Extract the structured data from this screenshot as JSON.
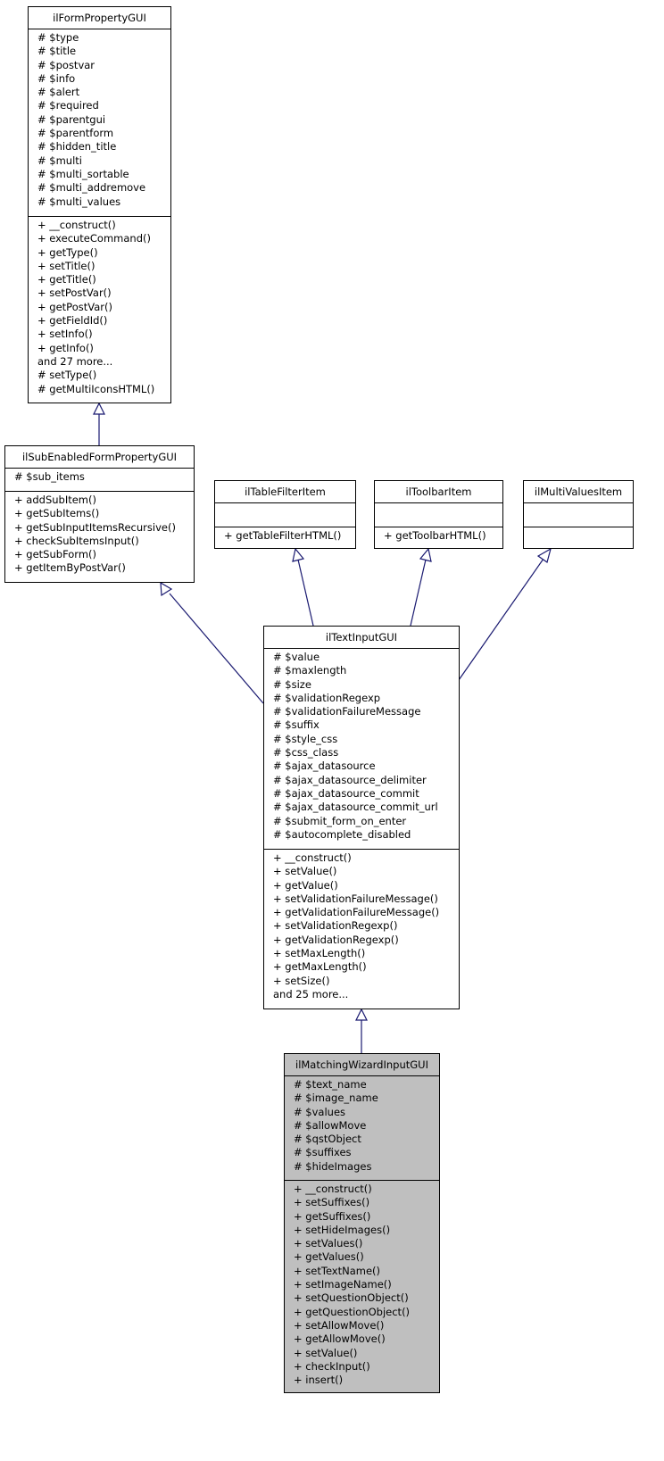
{
  "diagram": {
    "type": "class-inheritance",
    "classes": {
      "ilFormPropertyGUI": {
        "name": "ilFormPropertyGUI",
        "attributes": [
          "# $type",
          "# $title",
          "# $postvar",
          "# $info",
          "# $alert",
          "# $required",
          "# $parentgui",
          "# $parentform",
          "# $hidden_title",
          "# $multi",
          "# $multi_sortable",
          "# $multi_addremove",
          "# $multi_values"
        ],
        "methods": [
          "+ __construct()",
          "+ executeCommand()",
          "+ getType()",
          "+ setTitle()",
          "+ getTitle()",
          "+ setPostVar()",
          "+ getPostVar()",
          "+ getFieldId()",
          "+ setInfo()",
          "+ getInfo()",
          "and 27 more...",
          "# setType()",
          "# getMultiIconsHTML()"
        ]
      },
      "ilSubEnabledFormPropertyGUI": {
        "name": "ilSubEnabledFormPropertyGUI",
        "attributes": [
          "# $sub_items"
        ],
        "methods": [
          "+ addSubItem()",
          "+ getSubItems()",
          "+ getSubInputItemsRecursive()",
          "+ checkSubItemsInput()",
          "+ getSubForm()",
          "+ getItemByPostVar()"
        ]
      },
      "ilTableFilterItem": {
        "name": "ilTableFilterItem",
        "attributes": [],
        "methods": [
          "+ getTableFilterHTML()"
        ]
      },
      "ilToolbarItem": {
        "name": "ilToolbarItem",
        "attributes": [],
        "methods": [
          "+ getToolbarHTML()"
        ]
      },
      "ilMultiValuesItem": {
        "name": "ilMultiValuesItem",
        "attributes": [],
        "methods": []
      },
      "ilTextInputGUI": {
        "name": "ilTextInputGUI",
        "attributes": [
          "# $value",
          "# $maxlength",
          "# $size",
          "# $validationRegexp",
          "# $validationFailureMessage",
          "# $suffix",
          "# $style_css",
          "# $css_class",
          "# $ajax_datasource",
          "# $ajax_datasource_delimiter",
          "# $ajax_datasource_commit",
          "# $ajax_datasource_commit_url",
          "# $submit_form_on_enter",
          "# $autocomplete_disabled"
        ],
        "methods": [
          "+ __construct()",
          "+ setValue()",
          "+ getValue()",
          "+ setValidationFailureMessage()",
          "+ getValidationFailureMessage()",
          "+ setValidationRegexp()",
          "+ getValidationRegexp()",
          "+ setMaxLength()",
          "+ getMaxLength()",
          "+ setSize()",
          "and 25 more..."
        ]
      },
      "ilMatchingWizardInputGUI": {
        "name": "ilMatchingWizardInputGUI",
        "attributes": [
          "# $text_name",
          "# $image_name",
          "# $values",
          "# $allowMove",
          "# $qstObject",
          "# $suffixes",
          "# $hideImages"
        ],
        "methods": [
          "+ __construct()",
          "+ setSuffixes()",
          "+ getSuffixes()",
          "+ setHideImages()",
          "+ setValues()",
          "+ getValues()",
          "+ setTextName()",
          "+ setImageName()",
          "+ setQuestionObject()",
          "+ getQuestionObject()",
          "+ setAllowMove()",
          "+ getAllowMove()",
          "+ setValue()",
          "+ checkInput()",
          "+ insert()"
        ]
      }
    },
    "inheritance": [
      {
        "child": "ilSubEnabledFormPropertyGUI",
        "parent": "ilFormPropertyGUI"
      },
      {
        "child": "ilTextInputGUI",
        "parent": "ilSubEnabledFormPropertyGUI"
      },
      {
        "child": "ilTextInputGUI",
        "parent": "ilTableFilterItem"
      },
      {
        "child": "ilTextInputGUI",
        "parent": "ilToolbarItem"
      },
      {
        "child": "ilTextInputGUI",
        "parent": "ilMultiValuesItem"
      },
      {
        "child": "ilMatchingWizardInputGUI",
        "parent": "ilTextInputGUI"
      }
    ],
    "highlighted_class": "ilMatchingWizardInputGUI",
    "colors": {
      "edge": "#191970",
      "highlight_fill": "#bfbfbf",
      "box_border": "#000000"
    }
  }
}
